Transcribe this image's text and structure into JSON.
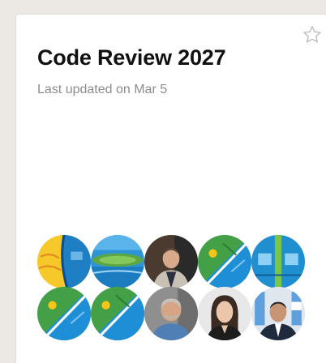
{
  "card": {
    "title": "Code Review 2027",
    "subtitle": "Last updated on Mar 5",
    "favorite_icon": "star-outline-icon"
  },
  "colors": {
    "background": "#ece9e4",
    "card": "#ffffff",
    "title": "#111111",
    "subtitle": "#8c8c8c",
    "avatar_blue": "#1f8fd0",
    "avatar_green": "#3d9a3a",
    "avatar_yellow": "#f5c518"
  },
  "members": [
    {
      "avatar": "map-avatar-yellow-blue"
    },
    {
      "avatar": "map-avatar-island"
    },
    {
      "avatar": "photo-avatar-man-dark"
    },
    {
      "avatar": "map-avatar-green-blue"
    },
    {
      "avatar": "map-avatar-blue-stripes"
    },
    {
      "avatar": "map-avatar-green-blue"
    },
    {
      "avatar": "map-avatar-green-blue"
    },
    {
      "avatar": "photo-avatar-man-bald"
    },
    {
      "avatar": "photo-avatar-woman"
    },
    {
      "avatar": "photo-avatar-man-suit"
    }
  ]
}
